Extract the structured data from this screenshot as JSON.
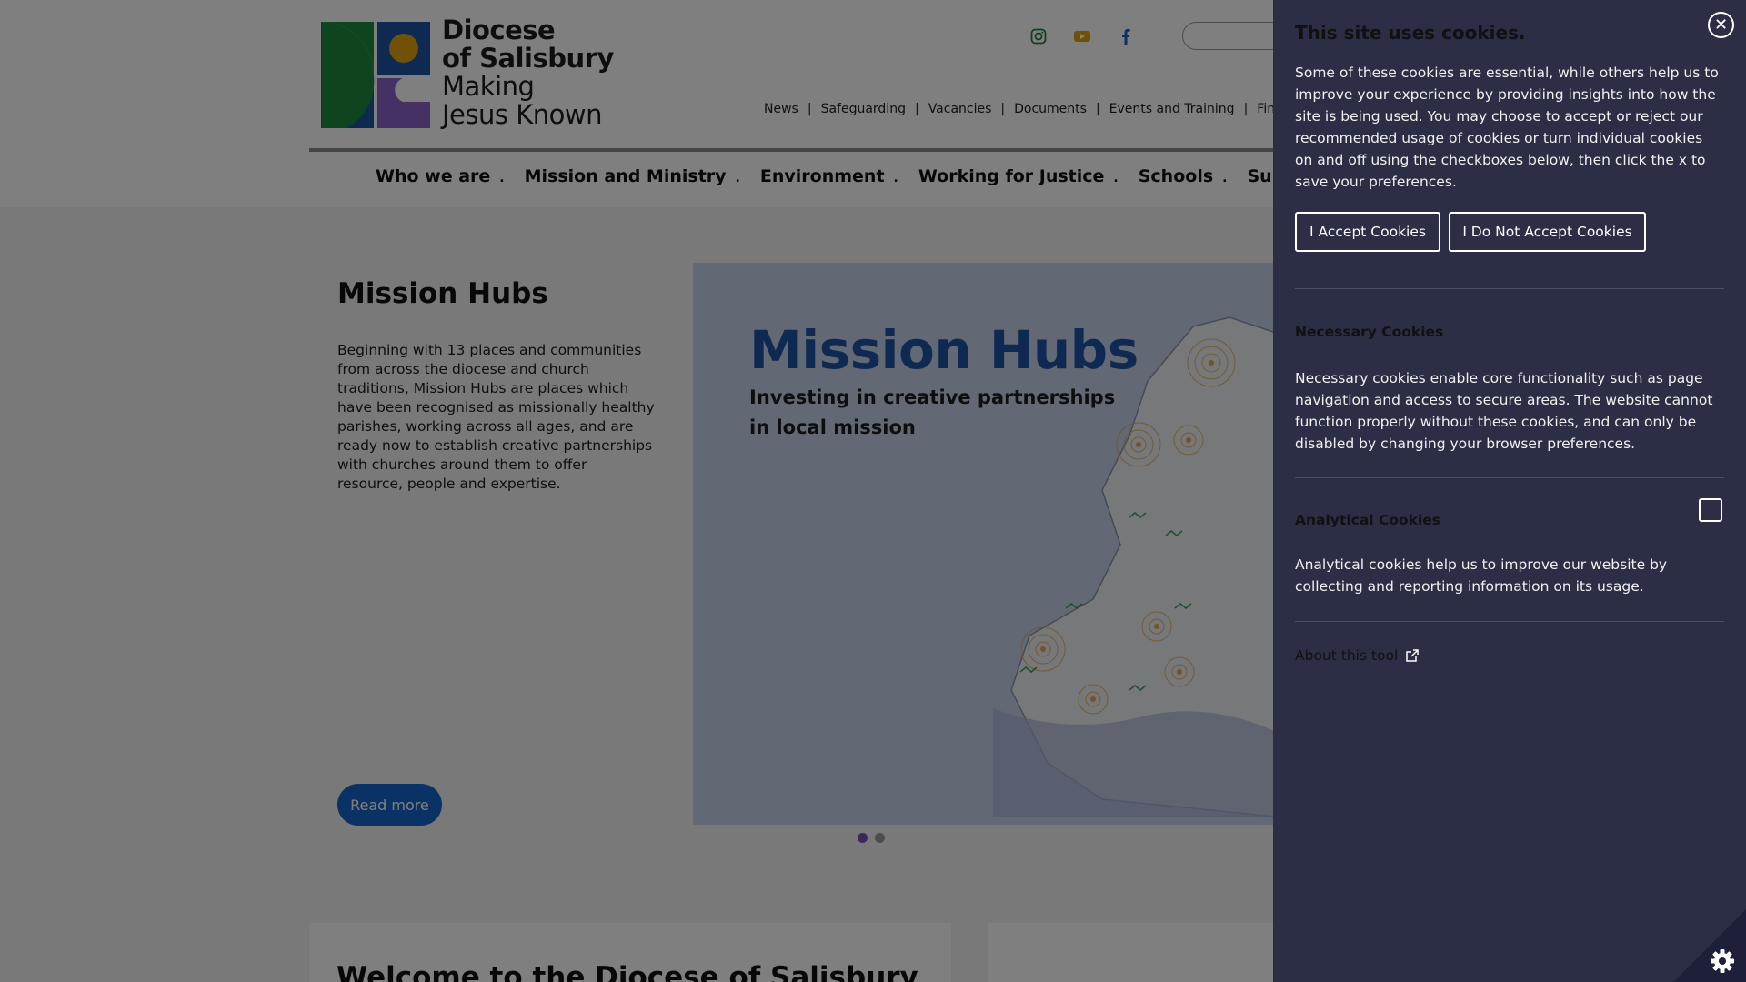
{
  "header": {
    "logo_line1": "Diocese",
    "logo_line2": "of Salisbury",
    "logo_line3": "Making",
    "logo_line4": "Jesus Known",
    "social_icons": [
      "instagram-icon",
      "youtube-icon",
      "facebook-icon"
    ],
    "utility_nav": [
      "News",
      "Safeguarding",
      "Vacancies",
      "Documents",
      "Events and Training",
      "Find"
    ],
    "main_nav": [
      "Who we are",
      "Mission and Ministry",
      "Environment",
      "Working for Justice",
      "Schools",
      "Support"
    ]
  },
  "slide": {
    "title": "Mission Hubs",
    "text": "Beginning with 13 places and communities from across the diocese and church traditions, Mission Hubs are places which have been recognised as missionally healthy parishes, working across all ages, and are ready now to establish creative partnerships with churches around them to offer resource, people and expertise.",
    "read_more": "Read more",
    "banner_title": "Mission Hubs",
    "banner_subtitle_line1": "Investing in creative partnerships",
    "banner_subtitle_line2": "in local mission"
  },
  "cards": {
    "welcome_title": "Welcome to the Diocese of Salisbury"
  },
  "cookie": {
    "title": "This site uses cookies.",
    "intro": "Some of these cookies are essential, while others help us to improve your experience by providing insights into how the site is being used. You may choose to accept or reject our recommended usage of cookies or turn individual cookies on and off using the checkboxes below, then click the x to save your preferences.",
    "accept_label": "I Accept Cookies",
    "reject_label": "I Do Not Accept Cookies",
    "necessary_title": "Necessary Cookies",
    "necessary_text": "Necessary cookies enable core functionality such as page navigation and access to secure areas. The website cannot function properly without these cookies, and can only be disabled by changing your browser preferences.",
    "analytical_title": "Analytical Cookies",
    "analytical_text": "Analytical cookies help us to improve our website by collecting and reporting information on its usage.",
    "analytical_checked": false,
    "about_label": "About this tool"
  },
  "colors": {
    "panel_bg": "#2b2e45",
    "button_blue": "#1565c9",
    "banner_title": "#1f55a5",
    "dot_active": "#7b4fc3"
  }
}
